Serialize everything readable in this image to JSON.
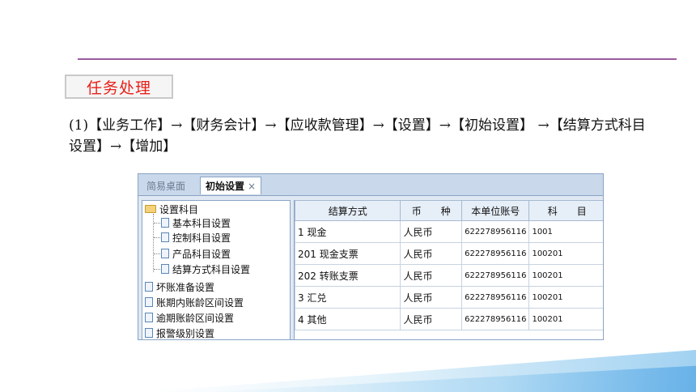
{
  "section_label": "任务处理",
  "instruction": "(1)【业务工作】→【财务会计】→【应收款管理】→【设置】→【初始设置】 →【结算方式科目设置】→【增加】",
  "window": {
    "tabs": [
      {
        "label": "简易桌面"
      },
      {
        "label": "初始设置",
        "close": "×"
      }
    ],
    "tree": {
      "root": "设置科目",
      "children": [
        "基本科目设置",
        "控制科目设置",
        "产品科目设置",
        "结算方式科目设置"
      ],
      "items": [
        "坏账准备设置",
        "账期内账龄区间设置",
        "逾期账龄区间设置",
        "报警级别设置"
      ]
    },
    "grid": {
      "columns": [
        "结算方式",
        "币　　种",
        "本单位账号",
        "科　　目"
      ],
      "rows": [
        [
          "1 现金",
          "人民币",
          "622278956116",
          "1001"
        ],
        [
          "201 现金支票",
          "人民币",
          "622278956116",
          "100201"
        ],
        [
          "202 转账支票",
          "人民币",
          "622278956116",
          "100201"
        ],
        [
          "3 汇兑",
          "人民币",
          "622278956116",
          "100201"
        ],
        [
          "4 其他",
          "人民币",
          "622278956116",
          "100201"
        ]
      ]
    }
  }
}
